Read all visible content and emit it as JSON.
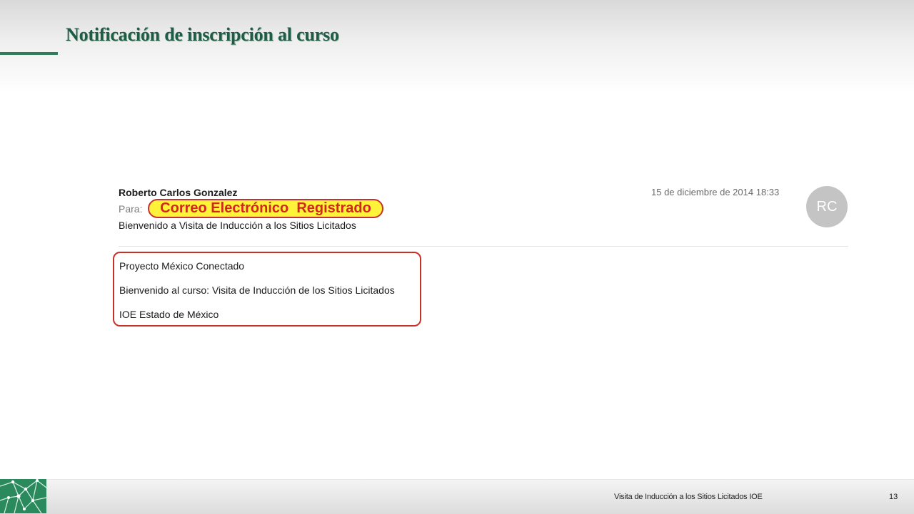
{
  "slide": {
    "title": "Notificación de inscripción al curso",
    "footer_text": "Visita de Inducción a los Sitios Licitados IOE",
    "page_number": "13"
  },
  "email": {
    "sender": "Roberto Carlos Gonzalez",
    "date": "15 de diciembre de 2014 18:33",
    "avatar_initials": "RC",
    "to_label": "Para:",
    "recipient_highlight": "Correo Electrónico  Registrado",
    "subject": "Bienvenido a Visita de Inducción a los Sitios Licitados",
    "body_lines": [
      "Proyecto México Conectado",
      "Bienvenido al curso: Visita de Inducción de los Sitios Licitados",
      "IOE Estado de México"
    ]
  },
  "colors": {
    "title": "#1f5c46",
    "accent_green": "#2e7d5b",
    "highlight_yellow": "#fff33a",
    "highlight_red": "#c8312a"
  },
  "icons": {
    "footer_logo": "network-mesh-icon"
  }
}
